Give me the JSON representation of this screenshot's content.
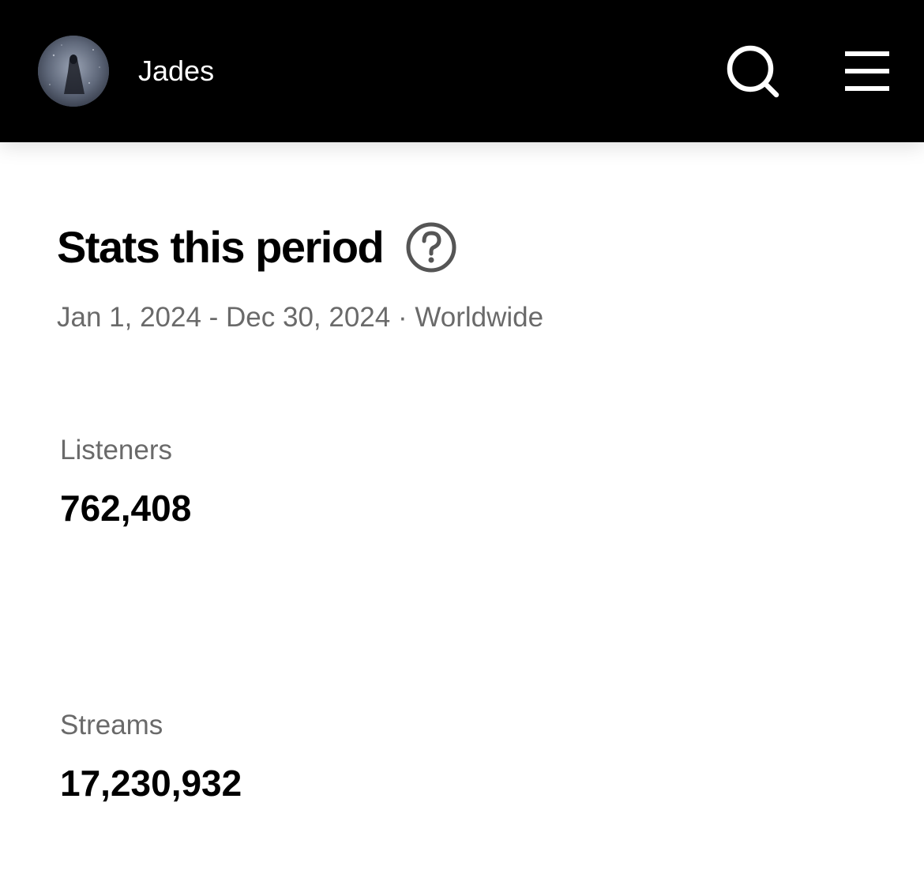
{
  "header": {
    "artist_name": "Jades",
    "avatar_icon": "artist-avatar",
    "search_icon": "search-icon",
    "menu_icon": "hamburger-menu-icon",
    "background_color": "#000000"
  },
  "main": {
    "title": "Stats this period",
    "help_icon": "question-circle-icon",
    "subtitle": "Jan 1, 2024 - Dec 30, 2024 · Worldwide",
    "stats": [
      {
        "label": "Listeners",
        "value": "762,408"
      },
      {
        "label": "Streams",
        "value": "17,230,932"
      }
    ]
  }
}
